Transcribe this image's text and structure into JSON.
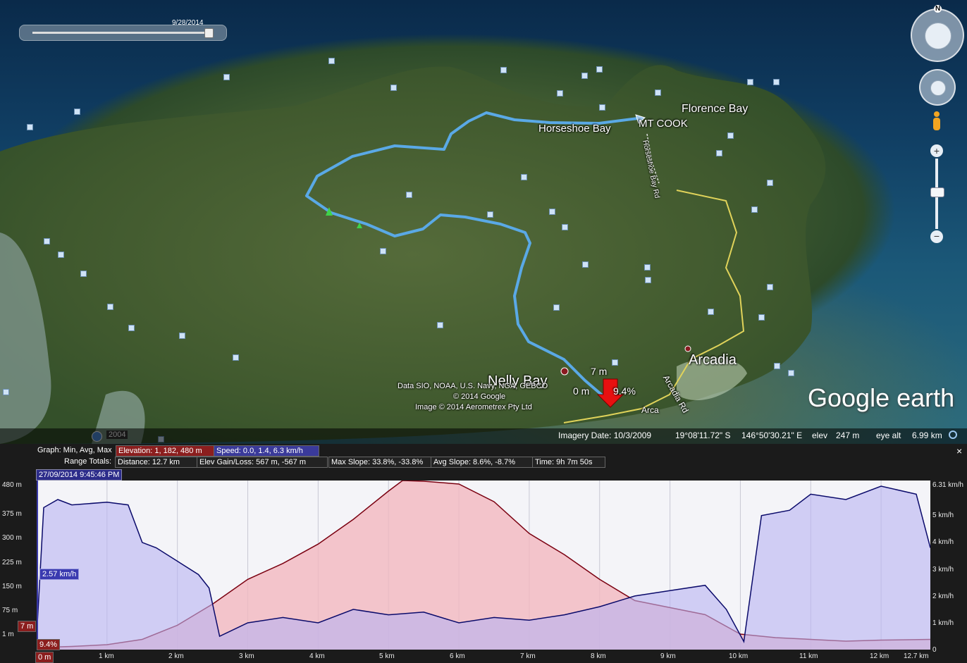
{
  "map": {
    "time_slider_date": "9/28/2014",
    "places": {
      "florence_bay": "Florence Bay",
      "mt_cook": "MT COOK",
      "horseshoe_bay": "Horseshoe Bay",
      "nelly_bay": "Nelly Bay",
      "arcadia": "Arcadia"
    },
    "road_labels": {
      "road1": "Horseshoe Bay Rd",
      "road2": "Arcadia Rd",
      "road3": "Arca"
    },
    "markers": {
      "top_value": "7 m",
      "zero_value": "0 m",
      "slope_value": "9.4%"
    },
    "attribution": {
      "line1": "Data SIO, NOAA, U.S. Navy, NGA, GEBCO",
      "line2": "© 2014 Google",
      "line3": "Image © 2014 Aerometrex Pty Ltd"
    },
    "logo": "Google earth",
    "historical_year": "2004",
    "compass_north": "N",
    "status": {
      "imagery_date": "Imagery Date: 10/3/2009",
      "lat": "19°08'11.72\" S",
      "lon": "146°50'30.21\" E",
      "elev_label": "elev",
      "elev_value": "247 m",
      "eye_alt_label": "eye alt",
      "eye_alt_value": "6.99 km"
    }
  },
  "profile": {
    "close_label": "×",
    "graph_label": "Graph: Min, Avg, Max",
    "elevation": "Elevation: 1, 182, 480 m",
    "speed": "Speed: 0.0, 1.4, 6.3 km/h",
    "range_totals_label": "Range Totals:",
    "distance": "Distance: 12.7 km",
    "gain_loss": "Elev Gain/Loss: 567 m, -567 m",
    "max_slope": "Max Slope: 33.8%, -33.8%",
    "avg_slope": "Avg Slope: 8.6%, -8.7%",
    "time": "Time: 9h 7m 50s",
    "cursor_timestamp": "27/09/2014 9:45:46 PM",
    "speed_callout": "2.57 km/h",
    "elev_callout": "7 m",
    "slope_callout": "9.4%",
    "x_start_callout": "0 m",
    "colors": {
      "elevation_line": "#7a0010",
      "elevation_fill": "#f3b8bf",
      "speed_line": "#0a0a6a",
      "speed_fill": "#b7b2f2",
      "plot_bg": "#f2f2f8"
    }
  },
  "chart_data": {
    "type": "area",
    "xlabel": "",
    "ylabel": "",
    "x_ticks": [
      "0 m",
      "1 km",
      "2 km",
      "3 km",
      "4 km",
      "5 km",
      "6 km",
      "7 km",
      "8 km",
      "9 km",
      "10 km",
      "11 km",
      "12 km",
      "12.7 km"
    ],
    "y_left_ticks": [
      "480 m",
      "375 m",
      "300 m",
      "225 m",
      "150 m",
      "75 m",
      "1 m"
    ],
    "y_right_ticks": [
      "6.31 km/h",
      "5 km/h",
      "4 km/h",
      "3 km/h",
      "2 km/h",
      "1 km/h",
      "0"
    ],
    "xlim": [
      0,
      12.7
    ],
    "ylim_left": [
      1,
      480
    ],
    "ylim_right": [
      0,
      6.31
    ],
    "series": [
      {
        "name": "Elevation",
        "axis": "left",
        "x": [
          0,
          0.5,
          1,
          1.5,
          2,
          2.5,
          3,
          3.5,
          4,
          4.5,
          5,
          5.2,
          5.5,
          6,
          6.5,
          7,
          7.5,
          8,
          8.5,
          9,
          9.5,
          10,
          10.5,
          11,
          11.5,
          12,
          12.7
        ],
        "y": [
          7,
          10,
          15,
          30,
          70,
          130,
          200,
          245,
          300,
          370,
          450,
          480,
          478,
          470,
          420,
          330,
          270,
          200,
          140,
          120,
          100,
          45,
          35,
          30,
          25,
          28,
          30
        ]
      },
      {
        "name": "Speed",
        "axis": "right",
        "x": [
          0,
          0.1,
          0.3,
          0.5,
          1,
          1.3,
          1.5,
          1.7,
          2,
          2.3,
          2.45,
          2.6,
          3,
          3.5,
          4,
          4.5,
          5,
          5.5,
          6,
          6.5,
          7,
          7.5,
          8,
          8.5,
          9,
          9.5,
          9.8,
          10.05,
          10.3,
          10.7,
          11,
          11.5,
          12,
          12.5,
          12.7
        ],
        "y": [
          0.5,
          5.3,
          5.6,
          5.4,
          5.5,
          5.4,
          4.0,
          3.8,
          3.3,
          2.8,
          2.3,
          0.5,
          1.0,
          1.2,
          1.0,
          1.5,
          1.3,
          1.4,
          1.0,
          1.2,
          1.1,
          1.3,
          1.6,
          2.0,
          2.2,
          2.4,
          1.5,
          0.3,
          5.0,
          5.2,
          5.8,
          5.6,
          6.1,
          5.8,
          3.8
        ]
      }
    ],
    "grid": true
  }
}
